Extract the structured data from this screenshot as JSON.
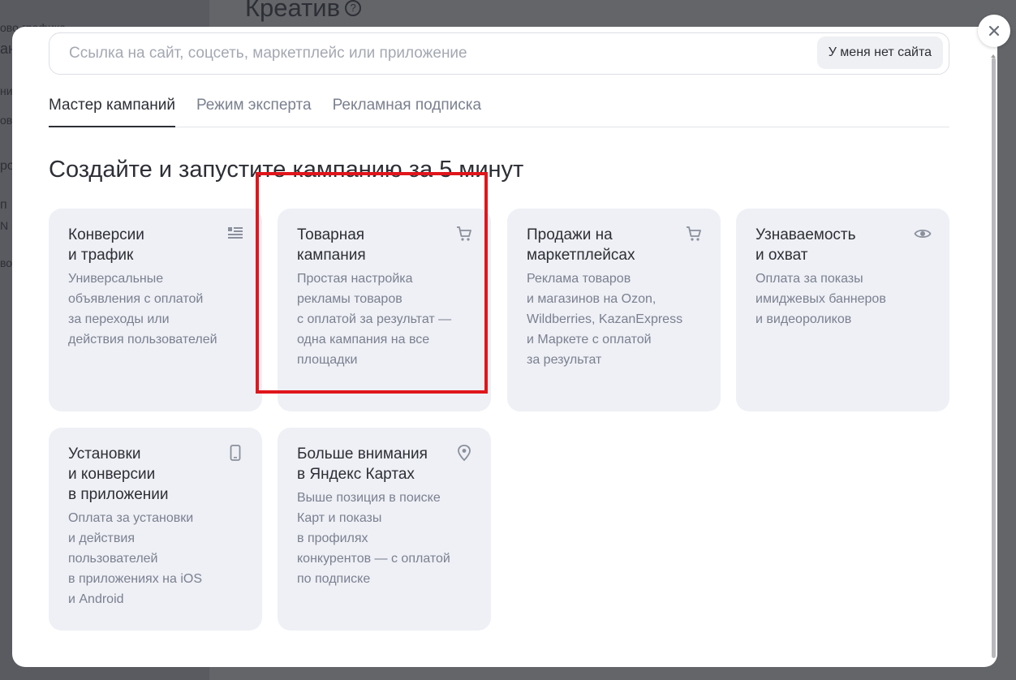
{
  "background": {
    "page_title": "Креатив",
    "sidebar_fragments": [
      "ово графика",
      "ан",
      "ни",
      "ов",
      "ро",
      "п",
      "N",
      "во"
    ]
  },
  "modal": {
    "url_field": {
      "placeholder": "Ссылка на сайт, соцсеть, маркетплейс или приложение",
      "value": ""
    },
    "no_site_button": "У меня нет сайта",
    "tabs": [
      {
        "label": "Мастер кампаний",
        "active": true
      },
      {
        "label": "Режим эксперта",
        "active": false
      },
      {
        "label": "Рекламная подписка",
        "active": false
      }
    ],
    "heading": "Создайте и запустите кампанию за 5 минут",
    "cards": [
      {
        "title": "Конверсии\nи трафик",
        "description": "Универсальные\nобъявления с оплатой\nза переходы или\nдействия пользователей",
        "icon": "list-icon"
      },
      {
        "title": "Товарная\nкампания",
        "description": "Простая настройка\nрекламы товаров\nс оплатой за результат —\nодна кампания на все\nплощадки",
        "icon": "cart-icon",
        "highlighted": true
      },
      {
        "title": "Продажи на\nмаркетплейсах",
        "description": "Реклама товаров\nи магазинов на Ozon,\nWildberries, KazanExpress\nи Маркете с оплатой\nза результат",
        "icon": "cart-icon"
      },
      {
        "title": "Узнаваемость\nи охват",
        "description": "Оплата за показы\nимиджевых баннеров\nи видеороликов",
        "icon": "eye-icon"
      },
      {
        "title": "Установки\nи конверсии\nв приложении",
        "description": "Оплата за установки\nи действия\nпользователей\nв приложениях на iOS\nи Android",
        "icon": "phone-icon"
      },
      {
        "title": "Больше внимания\nв Яндекс Картах",
        "description": "Выше позиция в поиске\nКарт и показы\nв профилях\nконкурентов — с оплатой\nпо подписке",
        "icon": "location-pin-icon"
      }
    ],
    "close_icon": "close-icon"
  },
  "colors": {
    "highlight": "#e0161c",
    "card_bg": "#eef0f5",
    "text_primary": "#2d2f36",
    "text_secondary": "#7b8090"
  }
}
